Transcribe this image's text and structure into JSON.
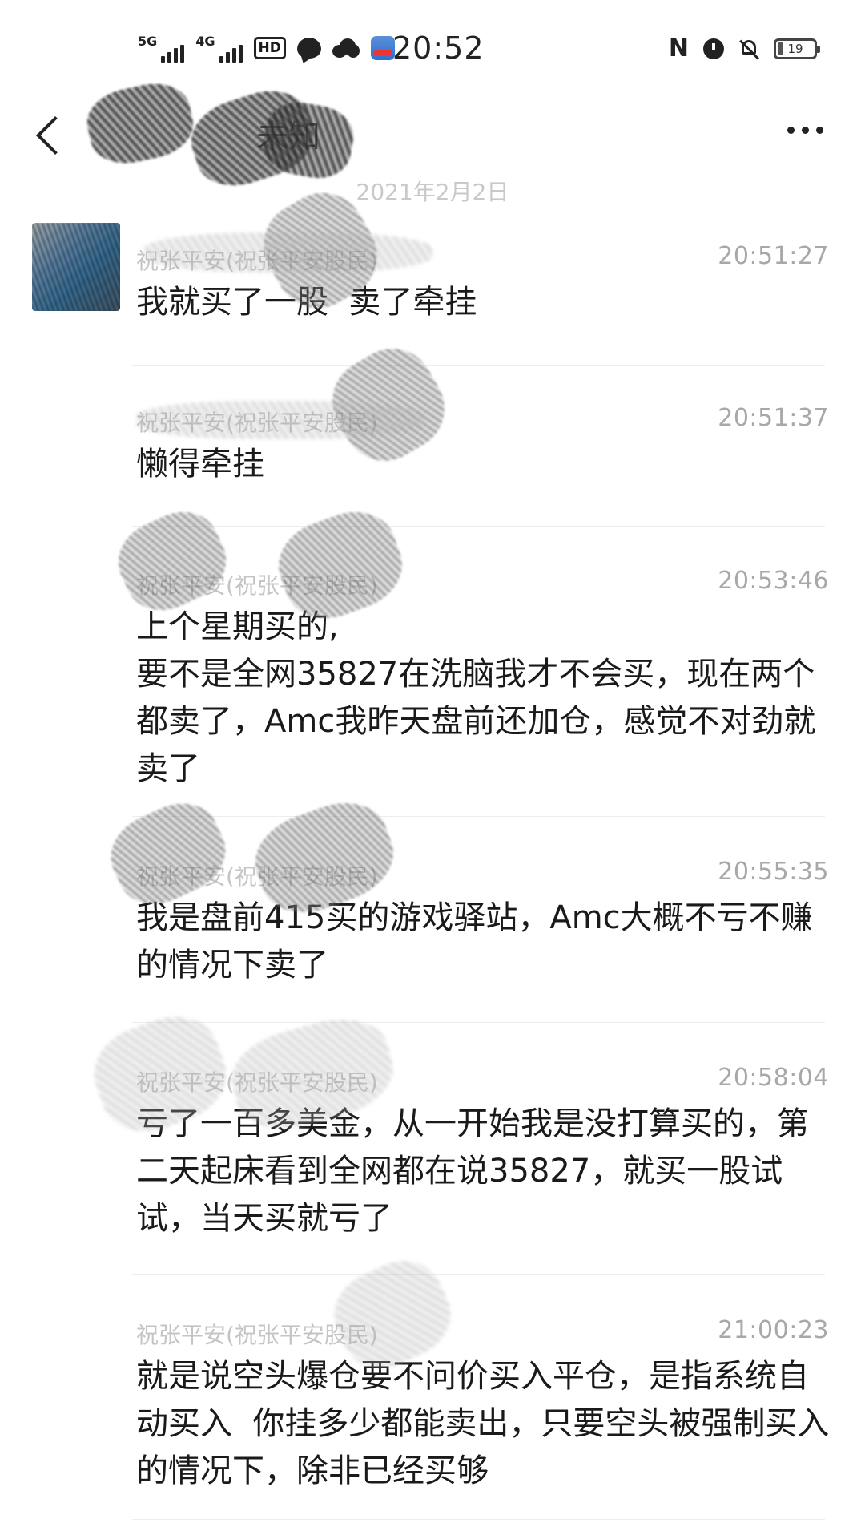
{
  "status_bar": {
    "net1": "5G",
    "net2": "4G",
    "hd": "HD",
    "time": "20:52",
    "nfc": "N",
    "battery": "19"
  },
  "header": {
    "title": "未知",
    "date": "2021年2月2日"
  },
  "messages": [
    {
      "sender": "祝张平安(祝张平安股民)",
      "time": "20:51:27",
      "text": "我就买了一股  卖了牵挂"
    },
    {
      "sender": "祝张平安(祝张平安股民)",
      "time": "20:51:37",
      "text": "懒得牵挂"
    },
    {
      "sender": "祝张平安(祝张平安股民)",
      "time": "20:53:46",
      "text": "上个星期买的,\n要不是全网35827在洗脑我才不会买，现在两个都卖了，Amc我昨天盘前还加仓，感觉不对劲就卖了"
    },
    {
      "sender": "祝张平安(祝张平安股民)",
      "time": "20:55:35",
      "text": "我是盘前415买的游戏驿站，Amc大概不亏不赚的情况下卖了"
    },
    {
      "sender": "祝张平安(祝张平安股民)",
      "time": "20:58:04",
      "text": "亏了一百多美金，从一开始我是没打算买的，第二天起床看到全网都在说35827，就买一股试试，当天买就亏了"
    },
    {
      "sender": "祝张平安(祝张平安股民)",
      "time": "21:00:23",
      "text": "就是说空头爆仓要不问价买入平仓，是指系统自动买入  你挂多少都能卖出，只要空头被强制买入的情况下，除非已经买够"
    }
  ],
  "icons": [
    "signal-icon",
    "hd-icon",
    "chat-icon",
    "cloud-icon",
    "app-icon",
    "nfc-icon",
    "alarm-icon",
    "mute-icon",
    "battery-icon",
    "back-icon",
    "more-icon"
  ]
}
